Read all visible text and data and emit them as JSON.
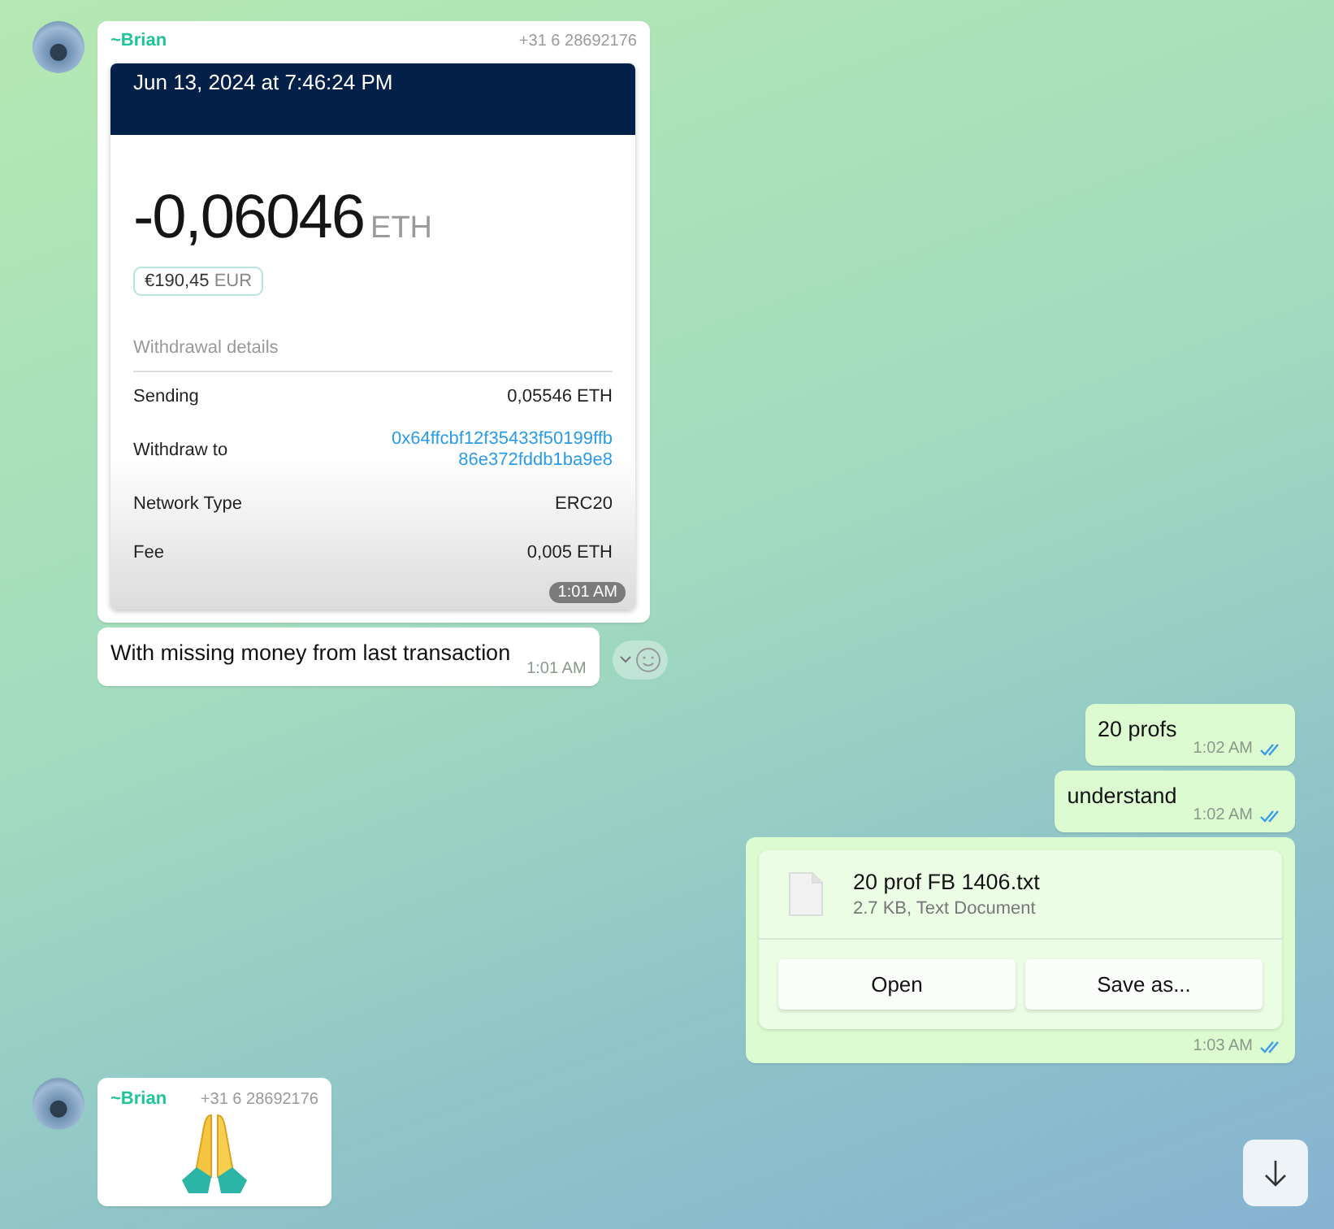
{
  "messages": [
    {
      "kind": "screenshot",
      "outgoing": false,
      "sender": "~Brian",
      "phone": "+31 6 28692176",
      "time": "1:01 AM",
      "screenshot": {
        "header_date": "Jun 13, 2024 at 7:46:24 PM",
        "amount": "-0,06046",
        "unit": "ETH",
        "fiat": "€190,45",
        "fiat_unit": "EUR",
        "section": "Withdrawal details",
        "rows": [
          {
            "label": "Sending",
            "value": "0,05546 ETH",
            "link": false
          },
          {
            "label": "Withdraw to",
            "value": "0x64ffcbf12f35433f50199ffb 86e372fddb1ba9e8",
            "link": true
          },
          {
            "label": "Network Type",
            "value": "ERC20",
            "link": false
          },
          {
            "label": "Fee",
            "value": "0,005 ETH",
            "link": false
          }
        ]
      }
    },
    {
      "kind": "text",
      "outgoing": false,
      "text": "With missing money from last transaction",
      "time": "1:01 AM",
      "hovered": true
    },
    {
      "kind": "text",
      "outgoing": true,
      "text": "20 profs",
      "time": "1:02 AM",
      "read": true
    },
    {
      "kind": "text",
      "outgoing": true,
      "text": "understand",
      "time": "1:02 AM",
      "read": true
    },
    {
      "kind": "file",
      "outgoing": true,
      "file_name": "20 prof FB 1406.txt",
      "file_meta": "2.7 KB, Text Document",
      "buttons": [
        "Open",
        "Save as..."
      ],
      "time": "1:03 AM",
      "read": true
    },
    {
      "kind": "emoji",
      "outgoing": false,
      "sender": "~Brian",
      "phone": "+31 6 28692176"
    }
  ]
}
